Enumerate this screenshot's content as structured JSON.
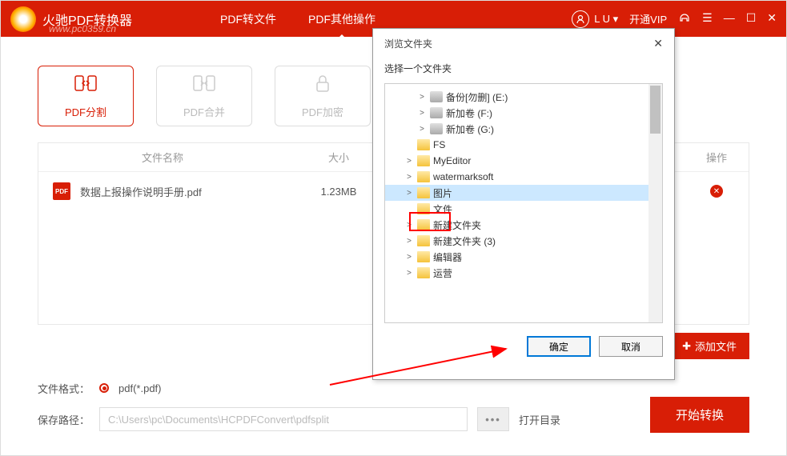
{
  "titlebar": {
    "app_title": "火驰PDF转换器",
    "watermark": "www.pc0359.cn",
    "nav": {
      "convert": "PDF转文件",
      "other": "PDF其他操作"
    },
    "user_label": "L U ▾",
    "vip_label": "开通VIP",
    "headset_icon": "headset",
    "menu_icon": "menu"
  },
  "toolbar": {
    "split": "PDF分割",
    "merge": "PDF合并",
    "encrypt": "PDF加密"
  },
  "table": {
    "headers": {
      "name": "文件名称",
      "size": "大小",
      "op": "操作"
    },
    "rows": [
      {
        "icon": "PDF",
        "name": "数据上报操作说明手册.pdf",
        "size": "1.23MB"
      }
    ]
  },
  "add_file_label": "添加文件",
  "bottom": {
    "format_label": "文件格式：",
    "format_value": "pdf(*.pdf)",
    "path_label": "保存路径：",
    "path_value": "C:\\Users\\pc\\Documents\\HCPDFConvert\\pdfsplit",
    "open_dir": "打开目录",
    "convert": "开始转换"
  },
  "dialog": {
    "title": "浏览文件夹",
    "subtitle": "选择一个文件夹",
    "tree": [
      {
        "indent": 2,
        "exp": ">",
        "type": "drive",
        "label": "备份[勿删] (E:)"
      },
      {
        "indent": 2,
        "exp": ">",
        "type": "drive",
        "label": "新加卷 (F:)"
      },
      {
        "indent": 2,
        "exp": ">",
        "type": "drive",
        "label": "新加卷 (G:)"
      },
      {
        "indent": 1,
        "exp": "",
        "type": "folder",
        "label": "FS"
      },
      {
        "indent": 1,
        "exp": ">",
        "type": "folder",
        "label": "MyEditor"
      },
      {
        "indent": 1,
        "exp": ">",
        "type": "folder",
        "label": "watermarksoft"
      },
      {
        "indent": 1,
        "exp": ">",
        "type": "folder",
        "label": "图片",
        "active": true
      },
      {
        "indent": 1,
        "exp": "",
        "type": "folder",
        "label": "文件",
        "highlighted": true
      },
      {
        "indent": 1,
        "exp": ">",
        "type": "folder",
        "label": "新建文件夹"
      },
      {
        "indent": 1,
        "exp": ">",
        "type": "folder",
        "label": "新建文件夹 (3)"
      },
      {
        "indent": 1,
        "exp": ">",
        "type": "folder",
        "label": "编辑器"
      },
      {
        "indent": 1,
        "exp": ">",
        "type": "folder",
        "label": "运营"
      }
    ],
    "ok": "确定",
    "cancel": "取消"
  }
}
